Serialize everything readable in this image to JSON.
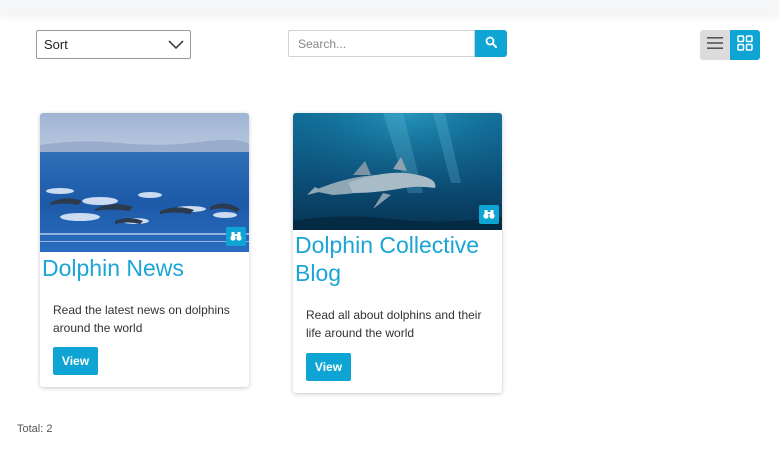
{
  "colors": {
    "accent": "#0ea5d4",
    "title": "#1aa5d6",
    "toggle_inactive": "#dcdcdc"
  },
  "toolbar": {
    "sort_label": "Sort",
    "search_placeholder": "Search...",
    "search_icon": "search-icon",
    "list_view_icon": "list-view-icon",
    "grid_view_icon": "grid-view-icon",
    "active_view": "grid"
  },
  "cards": [
    {
      "title": "Dolphin News",
      "description": "Read the latest news on dolphins around the world",
      "button_label": "View",
      "badge_icon": "binoculars-icon"
    },
    {
      "title": "Dolphin Collective Blog",
      "description": "Read all about dolphins and their life around the world",
      "button_label": "View",
      "badge_icon": "binoculars-icon"
    }
  ],
  "footer": {
    "total_text": "Total: 2"
  }
}
